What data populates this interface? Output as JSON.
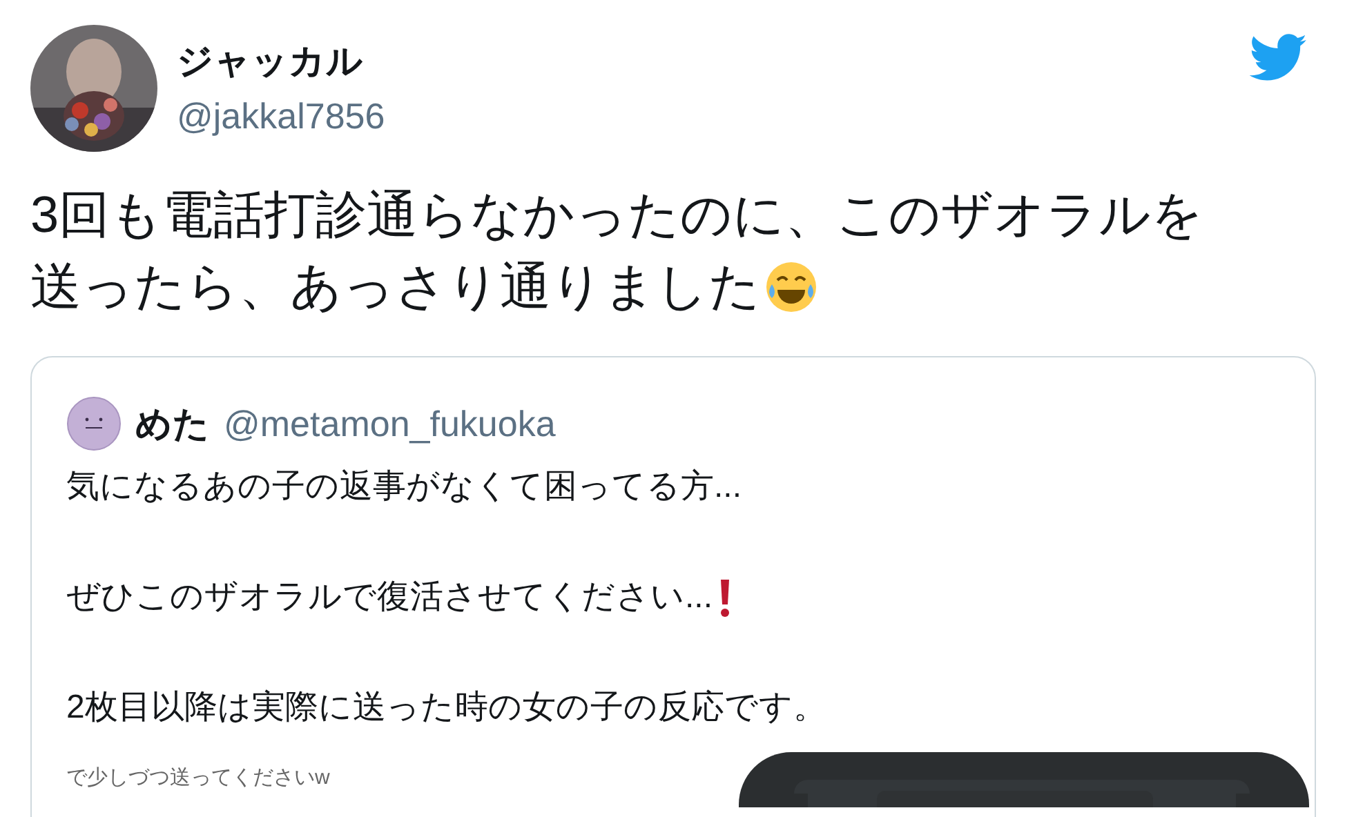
{
  "author": {
    "name": "ジャッカル",
    "handle": "@jakkal7856"
  },
  "tweet": {
    "lines": [
      "3回も電話打診通らなかったのに、このザオラルを",
      "送ったら、あっさり通りました"
    ]
  },
  "quoted": {
    "name": "めた",
    "handle": "@metamon_fukuoka",
    "paragraphs": [
      "気になるあの子の返事がなくて困ってる方...",
      "ぜひこのザオラルで復活させてください...",
      "2枚目以降は実際に送った時の女の子の反応です。"
    ],
    "media_caption": "で少しづつ送ってくださいw"
  }
}
